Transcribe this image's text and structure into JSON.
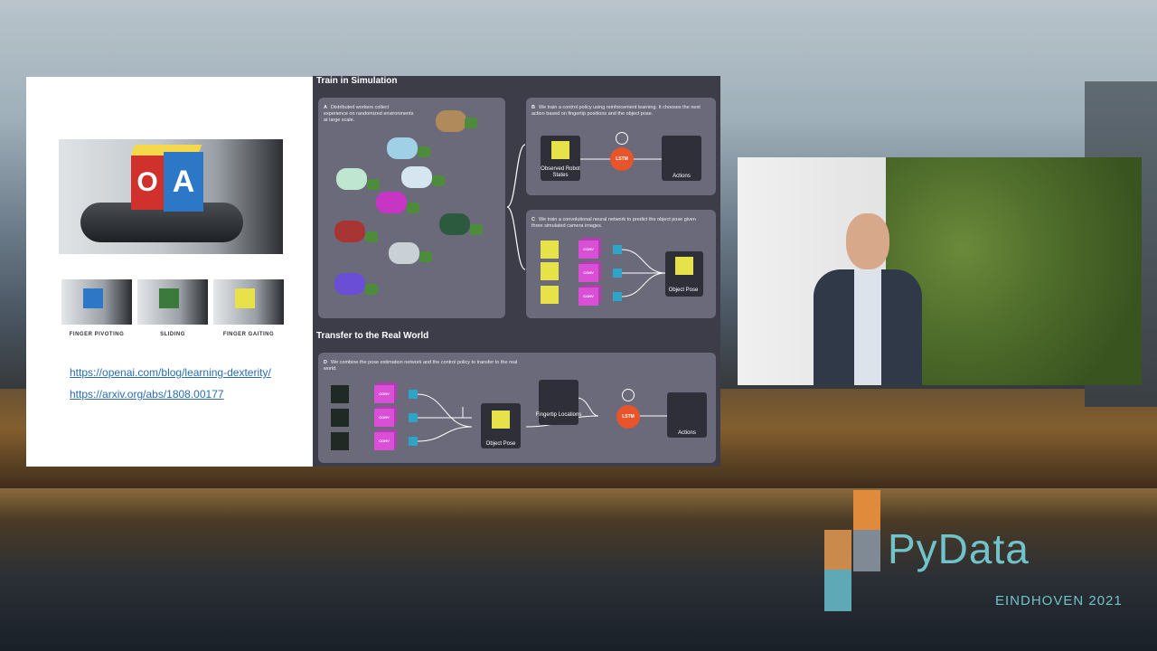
{
  "slide": {
    "thumb_labels": [
      "FINGER PIVOTING",
      "SLIDING",
      "FINGER GAITING"
    ],
    "links": [
      "https://openai.com/blog/learning-dexterity/",
      "https://arxiv.org/abs/1808.00177"
    ],
    "cube_letters": [
      "O",
      "A"
    ]
  },
  "diagram": {
    "title_sim": "Train in Simulation",
    "title_real": "Transfer to the Real World",
    "panel_a": {
      "letter": "A",
      "text": "Distributed workers collect experience on randomized environments at large scale."
    },
    "panel_b": {
      "letter": "B",
      "text": "We train a control policy using reinforcement learning. It chooses the next action based on fingertip positions and the object pose.",
      "input": "Observed Robot States",
      "lstm": "LSTM",
      "output": "Actions"
    },
    "panel_c": {
      "letter": "C",
      "text": "We train a convolutional neural network to predict the object pose given three simulated camera images.",
      "conv": "CONV",
      "output": "Object Pose"
    },
    "panel_d": {
      "letter": "D",
      "text": "We combine the pose estimation network and the control policy to transfer to the real world.",
      "conv": "CONV",
      "pose": "Object Pose",
      "fingertip": "Fingertip Locations",
      "lstm": "LSTM",
      "output": "Actions"
    }
  },
  "logo": {
    "name": "PyData",
    "sub": "EINDHOVEN 2021"
  },
  "colors": {
    "lstm": "#e8552b",
    "conv": "#d94fd6",
    "panel": "#6b6a7a",
    "logo": "#6fc3c9"
  }
}
